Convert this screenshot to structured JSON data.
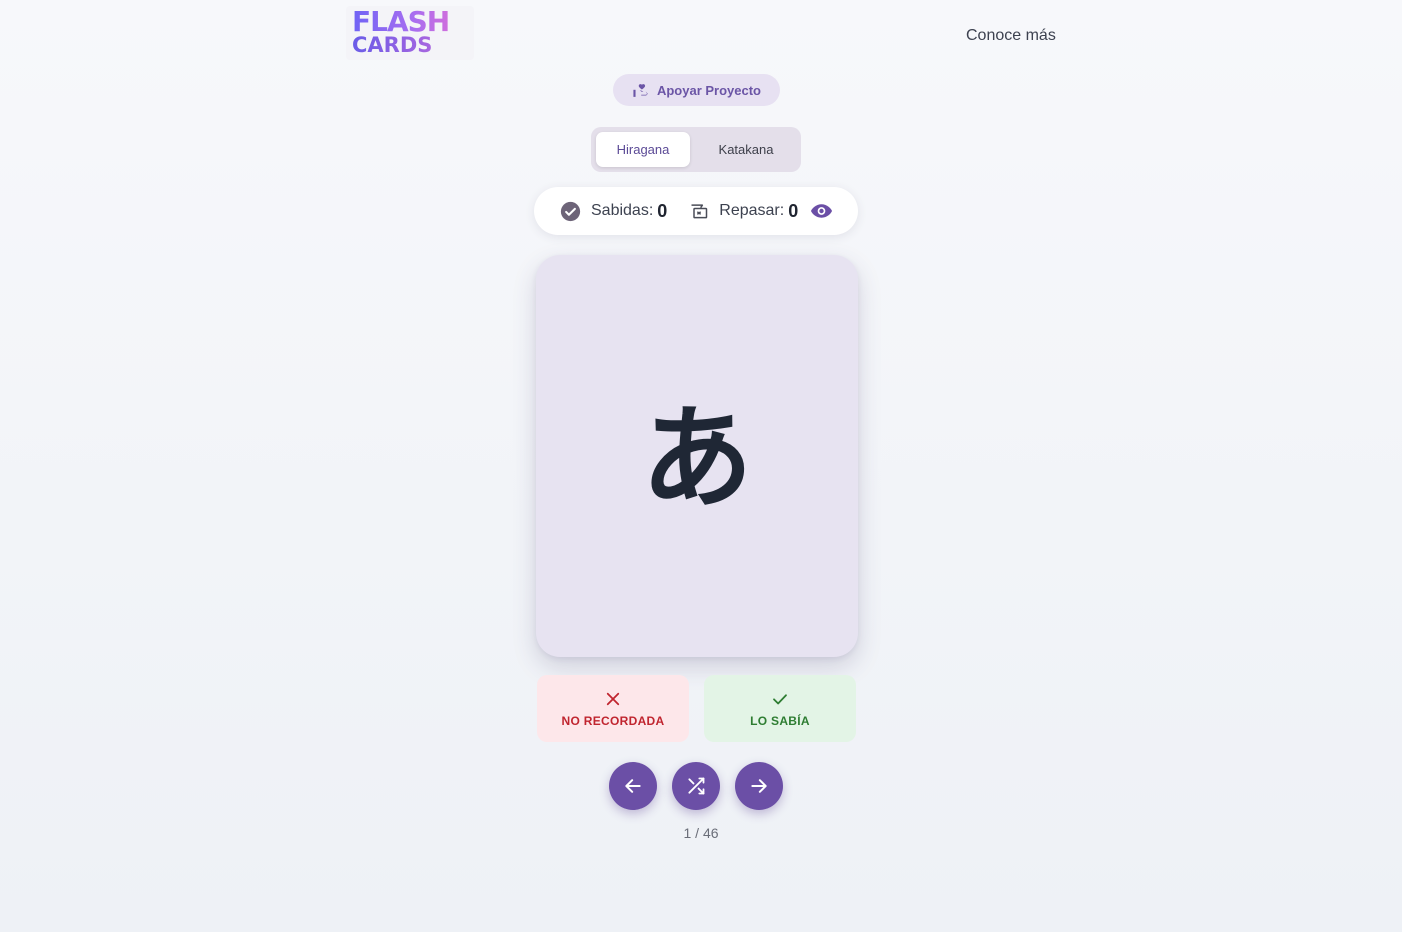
{
  "header": {
    "logo_line1": "FLASH",
    "logo_line2": "CARDS",
    "nav_link": "Conoce más"
  },
  "support": {
    "label": "Apoyar Proyecto",
    "icon": "hand-heart-icon"
  },
  "tabs": [
    {
      "label": "Hiragana",
      "active": true
    },
    {
      "label": "Katakana",
      "active": false
    }
  ],
  "stats": {
    "known_label": "Sabidas:",
    "known_count": "0",
    "review_label": "Repasar:",
    "review_count": "0"
  },
  "card": {
    "character": "あ"
  },
  "actions": {
    "not_remembered": "NO RECORDADA",
    "knew_it": "LO SABÍA"
  },
  "navigation": {
    "counter": "1 / 46"
  },
  "colors": {
    "primary": "#6b4fa6",
    "card_bg": "#e7e3f1",
    "danger": "#c0252f",
    "success": "#2e7d32"
  }
}
